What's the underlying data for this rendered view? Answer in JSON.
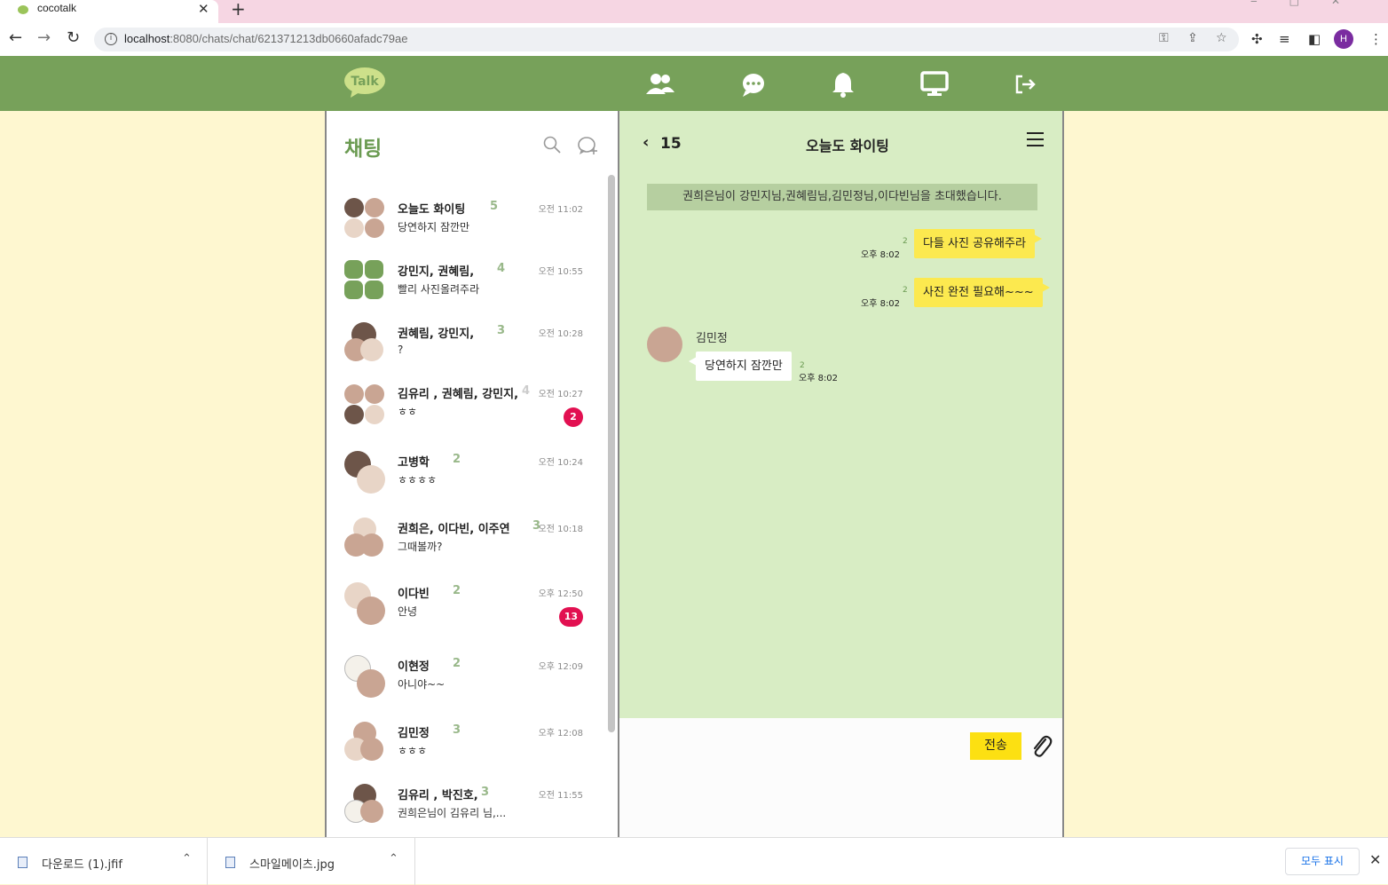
{
  "browser": {
    "tab_title": "cocotalk",
    "new_tab_symbol": "+",
    "close_symbol": "✕",
    "url_host": "localhost",
    "url_rest": ":8080/chats/chat/621371213db0660afadc79ae",
    "profile_initial": "H"
  },
  "app": {
    "brand_color": "#77a15a",
    "logo_text": "Talk",
    "nav_icons": [
      "friends-icon",
      "chat-icon",
      "bell-icon",
      "monitor-icon",
      "logout-icon"
    ]
  },
  "chat_list": {
    "title": "채팅",
    "rooms": [
      {
        "name": "오늘도 화이팅",
        "count": "5",
        "last_message": "당연하지 잠깐만",
        "time": "오전 11:02",
        "unread": ""
      },
      {
        "name": "강민지, 권혜림,",
        "count": "4",
        "last_message": "빨리 사진올려주라",
        "time": "오전 10:55",
        "unread": ""
      },
      {
        "name": "권혜림, 강민지,",
        "count": "3",
        "last_message": "?",
        "time": "오전 10:28",
        "unread": ""
      },
      {
        "name": "김유리 , 권혜림, 강민지,",
        "count": "4",
        "last_message": "ㅎㅎ",
        "time": "오전 10:27",
        "unread": "2"
      },
      {
        "name": "고병학",
        "count": "2",
        "last_message": "ㅎㅎㅎㅎ",
        "time": "오전 10:24",
        "unread": ""
      },
      {
        "name": "권희은, 이다빈, 이주연",
        "count": "3",
        "last_message": "그때볼까?",
        "time": "오전 10:18",
        "unread": ""
      },
      {
        "name": "이다빈",
        "count": "2",
        "last_message": "안녕",
        "time": "오후 12:50",
        "unread": "13"
      },
      {
        "name": "이현정",
        "count": "2",
        "last_message": "아니야~~",
        "time": "오후 12:09",
        "unread": ""
      },
      {
        "name": "김민정",
        "count": "3",
        "last_message": "ㅎㅎㅎ",
        "time": "오후 12:08",
        "unread": ""
      },
      {
        "name": "김유리 , 박진호,",
        "count": "3",
        "last_message": "권희은님이 김유리 님,...",
        "time": "오전 11:55",
        "unread": ""
      }
    ]
  },
  "chat": {
    "back_symbol": "‹",
    "member_count": "15",
    "title": "오늘도 화이팅",
    "system_notice": "권희은님이 강민지님,권혜림님,김민정님,이다빈님을 초대했습니다.",
    "outgoing": [
      {
        "text": "다들 사진 공유해주라",
        "time": "오후 8:02",
        "read": "2"
      },
      {
        "text": "사진 완전 필요해~~~",
        "time": "오후 8:02",
        "read": "2"
      }
    ],
    "incoming": {
      "sender": "김민정",
      "text": "당연하지 잠깐만",
      "time": "오후 8:02",
      "read": "2"
    },
    "send_label": "전송",
    "send_color": "#fce012"
  },
  "downloads": {
    "items": [
      {
        "name": "다운로드 (1).jfif"
      },
      {
        "name": "스마일메이츠.jpg"
      }
    ],
    "show_all": "모두 표시",
    "close_symbol": "✕"
  }
}
